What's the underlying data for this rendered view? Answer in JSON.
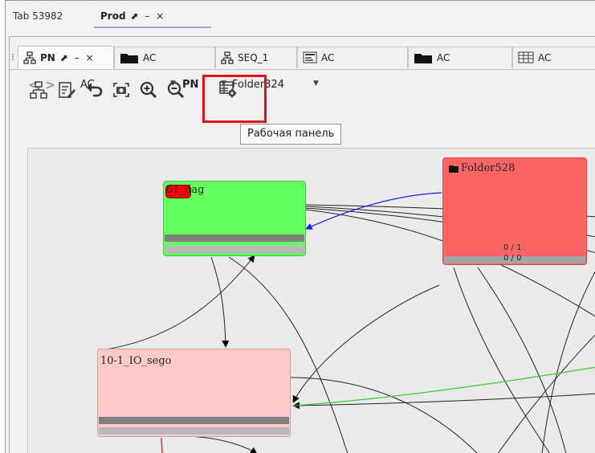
{
  "top_tabs": [
    {
      "label": "Tab 53982"
    },
    {
      "label": "Prod",
      "controls": "⬈ – ×"
    }
  ],
  "sub_tabs": [
    {
      "label": "PN",
      "icon": "hierarchy-icon",
      "controls": "⬈ – ×"
    },
    {
      "label": "AC",
      "icon": "folder-icon"
    },
    {
      "label": "SEQ_1",
      "icon": "hierarchy-icon"
    },
    {
      "label": "AC",
      "icon": "form-icon"
    },
    {
      "label": "AC",
      "icon": "folder-icon"
    },
    {
      "label": "AC",
      "icon": "table-icon"
    }
  ],
  "breadcrumb": {
    "back": "<",
    "forward": ">",
    "item1": "AC",
    "item2": "PN",
    "item3": "Folder324"
  },
  "toolbar": {
    "buttons": [
      "hierarchy-icon",
      "edit-form-icon",
      "undo-icon",
      "screenshot-icon",
      "zoom-in-icon",
      "zoom-out-icon",
      "dashboard-settings-icon"
    ]
  },
  "tooltip": "Рабочая панель",
  "nodes": {
    "dag": {
      "label": "01_dag",
      "color": "#62ff5e"
    },
    "folder": {
      "label": "Folder528",
      "count1": "0 / 1",
      "count2": "0 / 0",
      "color": "#ff6464"
    },
    "io": {
      "label": "10-1_IO_sego",
      "color": "#ffcaca"
    }
  },
  "colors": {
    "highlight": "#e0121f",
    "edge_blue": "#1a1aff",
    "edge_green": "#33cc33",
    "edge_red": "#ff2020"
  }
}
